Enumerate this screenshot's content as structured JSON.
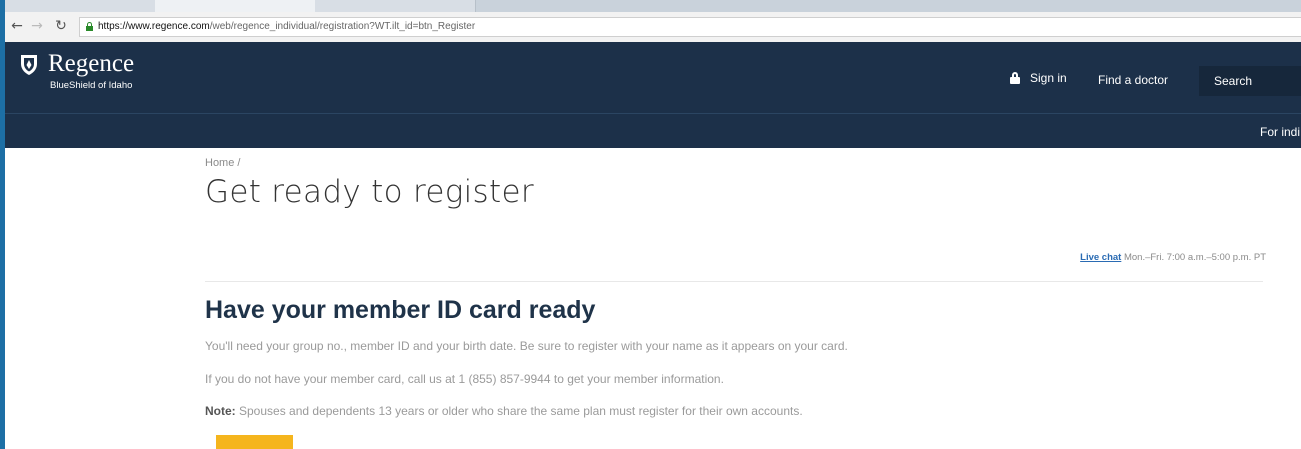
{
  "browser": {
    "url_host": "https://www.regence.com",
    "url_path": "/web/regence_individual/registration?WT.ilt_id=btn_Register"
  },
  "header": {
    "logo_name": "Regence",
    "logo_sub": "BlueShield of Idaho",
    "sign_in": "Sign in",
    "find_doctor": "Find a doctor",
    "search": "Search"
  },
  "subnav": {
    "item": "For indi"
  },
  "breadcrumb": "Home /",
  "page_title": "Get ready to register",
  "chat": {
    "link": "Live chat",
    "hours": " Mon.–Fri. 7:00 a.m.–5:00 p.m. PT"
  },
  "section": {
    "heading": "Have your member ID card ready",
    "p1": "You'll need your group no., member ID and your birth date. Be sure to register with your name as it appears on your card.",
    "p2": "If you do not have your member card, call us at 1 (855) 857-9944 to get your member information.",
    "note_label": "Note:",
    "note_text": " Spouses and dependents 13 years or older who share the same plan must register for their own accounts."
  },
  "colors": {
    "header_bg": "#1c3049",
    "accent_button": "#f5b51d",
    "frame_border": "#1d6fa5"
  }
}
